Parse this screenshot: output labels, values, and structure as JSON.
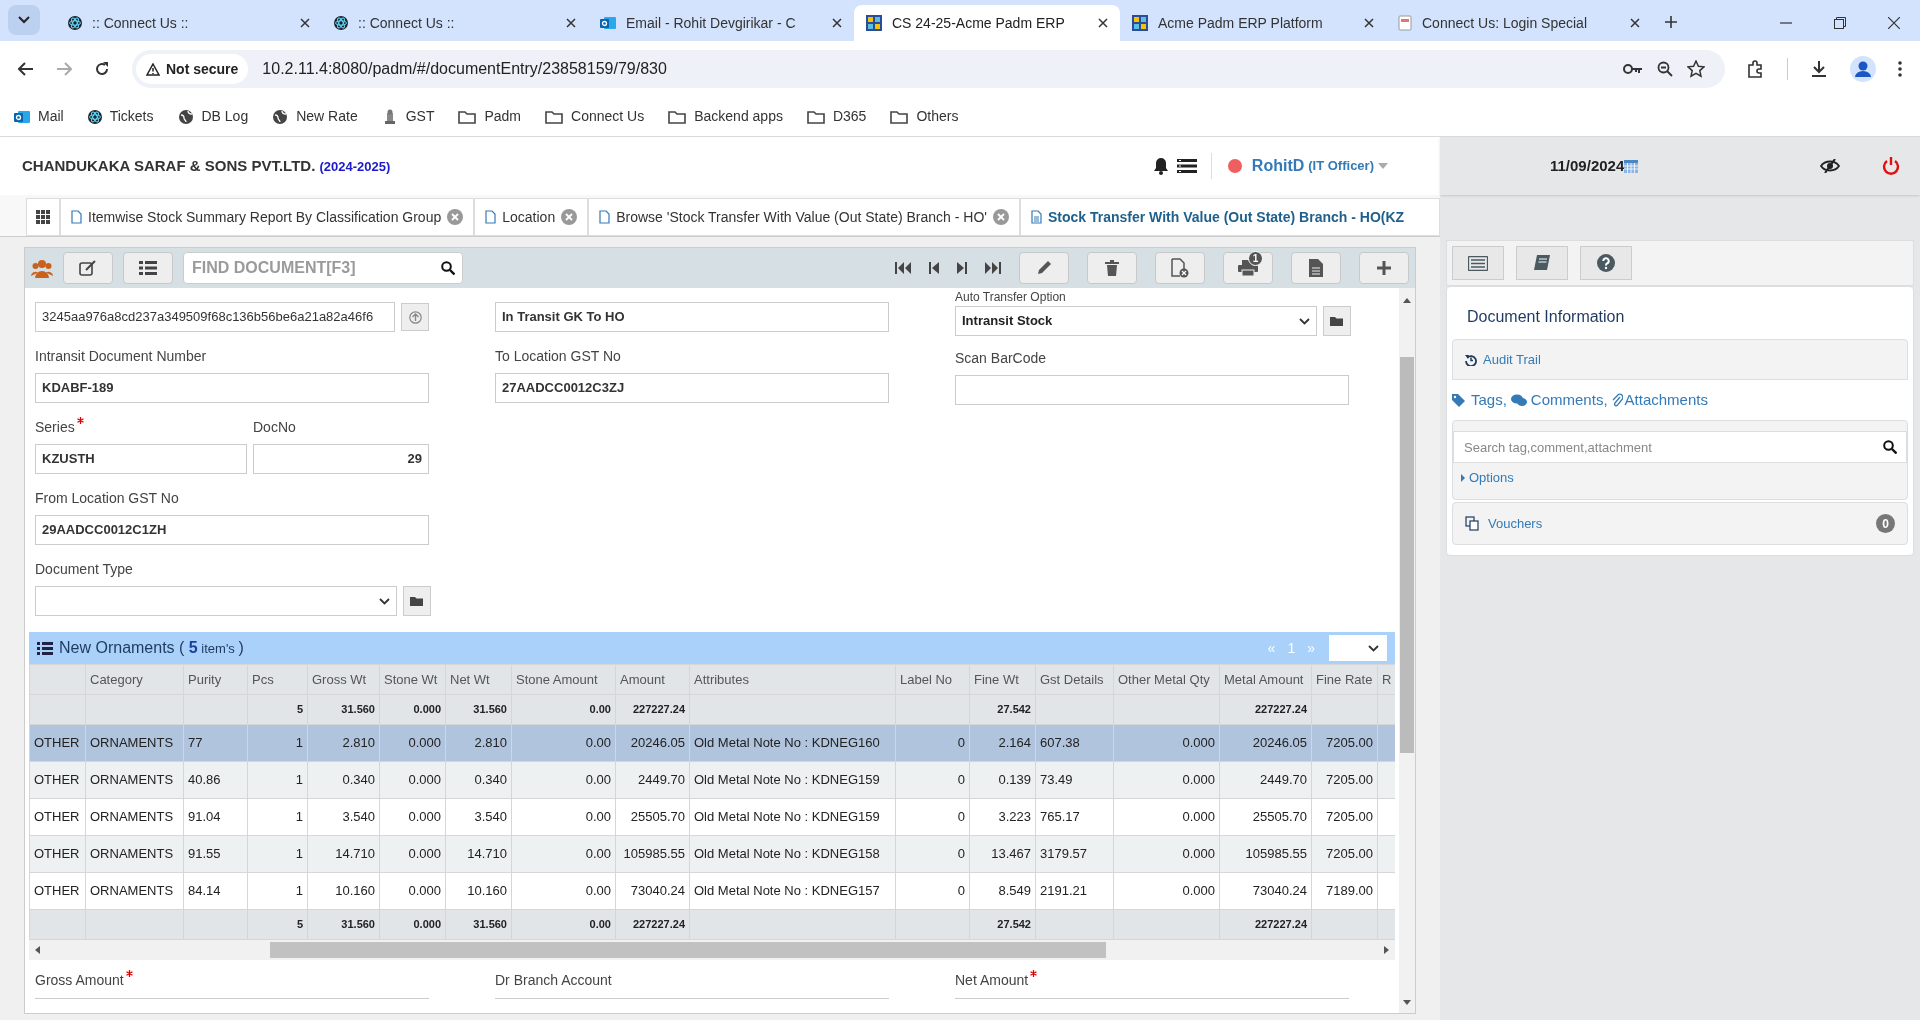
{
  "browser": {
    "tabs": [
      {
        "title": ":: Connect Us ::",
        "selected": false
      },
      {
        "title": ":: Connect Us ::",
        "selected": false
      },
      {
        "title": "Email - Rohit Devgirikar - C",
        "selected": false
      },
      {
        "title": "CS 24-25-Acme Padm ERP",
        "selected": true
      },
      {
        "title": "Acme Padm ERP Platform",
        "selected": false
      },
      {
        "title": "Connect Us: Login Special",
        "selected": false
      }
    ],
    "security": "Not secure",
    "url": "10.2.11.4:8080/padm/#/documentEntry/23858159/79/830",
    "bookmarks": [
      {
        "label": "Mail",
        "kind": "mail"
      },
      {
        "label": "Tickets",
        "kind": "react"
      },
      {
        "label": "DB Log",
        "kind": "globe"
      },
      {
        "label": "New Rate",
        "kind": "globe"
      },
      {
        "label": "GST",
        "kind": "emblem"
      },
      {
        "label": "Padm",
        "kind": "folder"
      },
      {
        "label": "Connect Us",
        "kind": "folder"
      },
      {
        "label": "Backend apps",
        "kind": "folder"
      },
      {
        "label": "D365",
        "kind": "folder"
      },
      {
        "label": "Others",
        "kind": "folder"
      }
    ]
  },
  "app": {
    "company": "CHANDUKAKA SARAF & SONS PVT.LTD.",
    "year": "(2024-2025)",
    "user": "RohitD",
    "role": "(IT Officer)",
    "date": "11/09/2024"
  },
  "doc_tabs": [
    {
      "label": "Itemwise Stock Summary Report By Classification Group",
      "selected": false
    },
    {
      "label": "Location",
      "selected": false
    },
    {
      "label": "Browse 'Stock Transfer With Value (Out State) Branch - HO'",
      "selected": false
    },
    {
      "label": "Stock Transfer With Value (Out State) Branch - HO(KZ",
      "selected": true
    }
  ],
  "toolbar": {
    "find_placeholder": "FIND DOCUMENT[F3]",
    "print_badge": "1"
  },
  "form": {
    "hash": "3245aa976a8cd237a349509f68c136b56be6a21a82a46f6",
    "intransit_label": "Intransit Document Number",
    "intransit": "KDABF-189",
    "series_label": "Series",
    "series_required": true,
    "series": "KZUSTH",
    "docno_label": "DocNo",
    "docno": "29",
    "from_gst_label": "From Location GST No",
    "from_gst": "29AADCC0012C1ZH",
    "doctype_label": "Document Type",
    "location": "In Transit GK To HO",
    "to_gst_label": "To Location GST No",
    "to_gst": "27AADCC0012C3ZJ",
    "auto_label": "Auto Transfer Option",
    "auto": "Intransit Stock",
    "barcode_label": "Scan BarCode"
  },
  "grid": {
    "title": "New Ornaments",
    "count": "5",
    "title_open": "(",
    "count_suffix": "item's",
    "title_close": ")",
    "pager_prev": "«",
    "page": "1",
    "pager_next": "»",
    "columns": [
      "Category",
      "Purity",
      "Pcs",
      "Gross Wt",
      "Stone Wt",
      "Net Wt",
      "Stone Amount",
      "Amount",
      "Attributes",
      "Label No",
      "Fine Wt",
      "Gst Details",
      "Other Metal Qty",
      "Metal Amount",
      "Fine Rate",
      "R"
    ],
    "top_total": {
      "pcs": "5",
      "gross_wt": "31.560",
      "stone_wt": "0.000",
      "net_wt": "31.560",
      "stone_amount": "0.00",
      "amount": "227227.24",
      "fine_wt": "27.542",
      "metal_amount": "227227.24"
    },
    "rows": [
      {
        "selected": true,
        "group": "OTHER",
        "cells": [
          "ORNAMENTS",
          "77",
          "1",
          "2.810",
          "0.000",
          "2.810",
          "0.00",
          "20246.05",
          "Old Metal Note No : KDNEG160",
          "0",
          "2.164",
          "607.38",
          "0.000",
          "20246.05",
          "7205.00"
        ]
      },
      {
        "selected": false,
        "group": "OTHER",
        "cells": [
          "ORNAMENTS",
          "40.86",
          "1",
          "0.340",
          "0.000",
          "0.340",
          "0.00",
          "2449.70",
          "Old Metal Note No : KDNEG159",
          "0",
          "0.139",
          "73.49",
          "0.000",
          "2449.70",
          "7205.00"
        ]
      },
      {
        "selected": false,
        "group": "OTHER",
        "cells": [
          "ORNAMENTS",
          "91.04",
          "1",
          "3.540",
          "0.000",
          "3.540",
          "0.00",
          "25505.70",
          "Old Metal Note No : KDNEG159",
          "0",
          "3.223",
          "765.17",
          "0.000",
          "25505.70",
          "7205.00"
        ]
      },
      {
        "selected": false,
        "group": "OTHER",
        "cells": [
          "ORNAMENTS",
          "91.55",
          "1",
          "14.710",
          "0.000",
          "14.710",
          "0.00",
          "105985.55",
          "Old Metal Note No : KDNEG158",
          "0",
          "13.467",
          "3179.57",
          "0.000",
          "105985.55",
          "7205.00"
        ]
      },
      {
        "selected": false,
        "group": "OTHER",
        "cells": [
          "ORNAMENTS",
          "84.14",
          "1",
          "10.160",
          "0.000",
          "10.160",
          "0.00",
          "73040.24",
          "Old Metal Note No : KDNEG157",
          "0",
          "8.549",
          "2191.21",
          "0.000",
          "73040.24",
          "7189.00"
        ]
      }
    ],
    "bottom_total": {
      "pcs": "5",
      "gross_wt": "31.560",
      "stone_wt": "0.000",
      "net_wt": "31.560",
      "stone_amount": "0.00",
      "amount": "227227.24",
      "fine_wt": "27.542",
      "metal_amount": "227227.24"
    }
  },
  "footer_fields": [
    {
      "label": "Gross Amount",
      "required": true
    },
    {
      "label": "Dr Branch Account",
      "required": false
    },
    {
      "label": "Net Amount",
      "required": true
    }
  ],
  "side": {
    "title": "Document Information",
    "audit": "Audit Trail",
    "tags": "Tags,",
    "comments": "Comments,",
    "attachments": "Attachments",
    "search_placeholder": "Search tag,comment,attachment",
    "options": "Options",
    "vouchers": "Vouchers",
    "voucher_count": "0"
  }
}
